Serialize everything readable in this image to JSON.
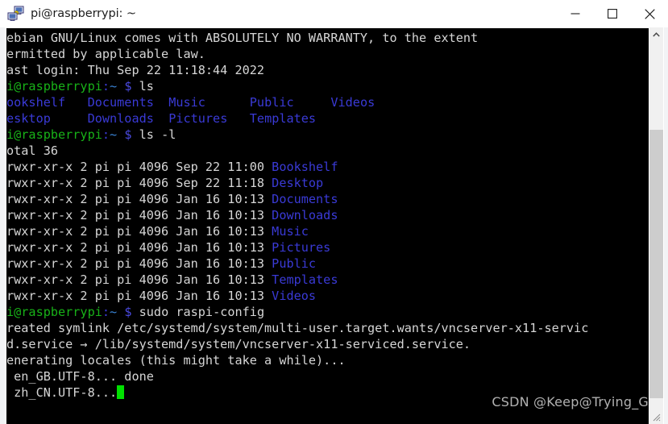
{
  "window": {
    "title": "pi@raspberrypi: ~",
    "icon": "putty-icon",
    "controls": {
      "minimize": "—",
      "maximize": "□",
      "close": "✕",
      "minimize_label": "Minimize",
      "maximize_label": "Maximize",
      "close_label": "Close"
    }
  },
  "scrollbar": {
    "up_arrow": "⌃",
    "resize_grip": "resize-grip-icon"
  },
  "watermark": {
    "text": "CSDN @Keep@Trying_G"
  },
  "terminal": {
    "colors": {
      "background": "#000000",
      "foreground": "#d6d6d6",
      "prompt_user": "#18b218",
      "directory": "#3a3ad6",
      "cursor": "#00e000"
    },
    "prompt": {
      "user_host": "i@raspberrypi",
      "colon": ":",
      "path": "~",
      "sigil": "$"
    },
    "lines": [
      {
        "id": "l1",
        "type": "text",
        "text": "ebian GNU/Linux comes with ABSOLUTELY NO WARRANTY, to the extent"
      },
      {
        "id": "l2",
        "type": "text",
        "text": "ermitted by applicable law."
      },
      {
        "id": "l3",
        "type": "text",
        "text": "ast login: Thu Sep 22 11:18:44 2022"
      },
      {
        "id": "l4",
        "type": "prompt",
        "command": "ls"
      },
      {
        "id": "l5",
        "type": "dirs",
        "cells": [
          "ookshelf",
          "Documents",
          "Music",
          "Public",
          "Videos"
        ]
      },
      {
        "id": "l6",
        "type": "dirs",
        "cells": [
          "esktop",
          "Downloads",
          "Pictures",
          "Templates"
        ]
      },
      {
        "id": "l7",
        "type": "prompt",
        "command": "ls -l"
      },
      {
        "id": "l8",
        "type": "text",
        "text": "otal 36"
      },
      {
        "id": "l9",
        "type": "listing",
        "perms": "rwxr-xr-x",
        "links": "2",
        "owner": "pi",
        "group": "pi",
        "size": "4096",
        "month": "Sep",
        "day": "22",
        "time": "11:00",
        "name": "Bookshelf"
      },
      {
        "id": "l10",
        "type": "listing",
        "perms": "rwxr-xr-x",
        "links": "2",
        "owner": "pi",
        "group": "pi",
        "size": "4096",
        "month": "Sep",
        "day": "22",
        "time": "11:18",
        "name": "Desktop"
      },
      {
        "id": "l11",
        "type": "listing",
        "perms": "rwxr-xr-x",
        "links": "2",
        "owner": "pi",
        "group": "pi",
        "size": "4096",
        "month": "Jan",
        "day": "16",
        "time": "10:13",
        "name": "Documents"
      },
      {
        "id": "l12",
        "type": "listing",
        "perms": "rwxr-xr-x",
        "links": "2",
        "owner": "pi",
        "group": "pi",
        "size": "4096",
        "month": "Jan",
        "day": "16",
        "time": "10:13",
        "name": "Downloads"
      },
      {
        "id": "l13",
        "type": "listing",
        "perms": "rwxr-xr-x",
        "links": "2",
        "owner": "pi",
        "group": "pi",
        "size": "4096",
        "month": "Jan",
        "day": "16",
        "time": "10:13",
        "name": "Music"
      },
      {
        "id": "l14",
        "type": "listing",
        "perms": "rwxr-xr-x",
        "links": "2",
        "owner": "pi",
        "group": "pi",
        "size": "4096",
        "month": "Jan",
        "day": "16",
        "time": "10:13",
        "name": "Pictures"
      },
      {
        "id": "l15",
        "type": "listing",
        "perms": "rwxr-xr-x",
        "links": "2",
        "owner": "pi",
        "group": "pi",
        "size": "4096",
        "month": "Jan",
        "day": "16",
        "time": "10:13",
        "name": "Public"
      },
      {
        "id": "l16",
        "type": "listing",
        "perms": "rwxr-xr-x",
        "links": "2",
        "owner": "pi",
        "group": "pi",
        "size": "4096",
        "month": "Jan",
        "day": "16",
        "time": "10:13",
        "name": "Templates"
      },
      {
        "id": "l17",
        "type": "listing",
        "perms": "rwxr-xr-x",
        "links": "2",
        "owner": "pi",
        "group": "pi",
        "size": "4096",
        "month": "Jan",
        "day": "16",
        "time": "10:13",
        "name": "Videos"
      },
      {
        "id": "l18",
        "type": "prompt",
        "command": "sudo raspi-config"
      },
      {
        "id": "l19",
        "type": "text",
        "text": "reated symlink /etc/systemd/system/multi-user.target.wants/vncserver-x11-servic"
      },
      {
        "id": "l20",
        "type": "text",
        "text": "d.service → /lib/systemd/system/vncserver-x11-serviced.service."
      },
      {
        "id": "l21",
        "type": "text",
        "text": "enerating locales (this might take a while)..."
      },
      {
        "id": "l22",
        "type": "text",
        "text": " en_GB.UTF-8... done"
      },
      {
        "id": "l23",
        "type": "cursorline",
        "text": " zh_CN.UTF-8..."
      }
    ]
  }
}
